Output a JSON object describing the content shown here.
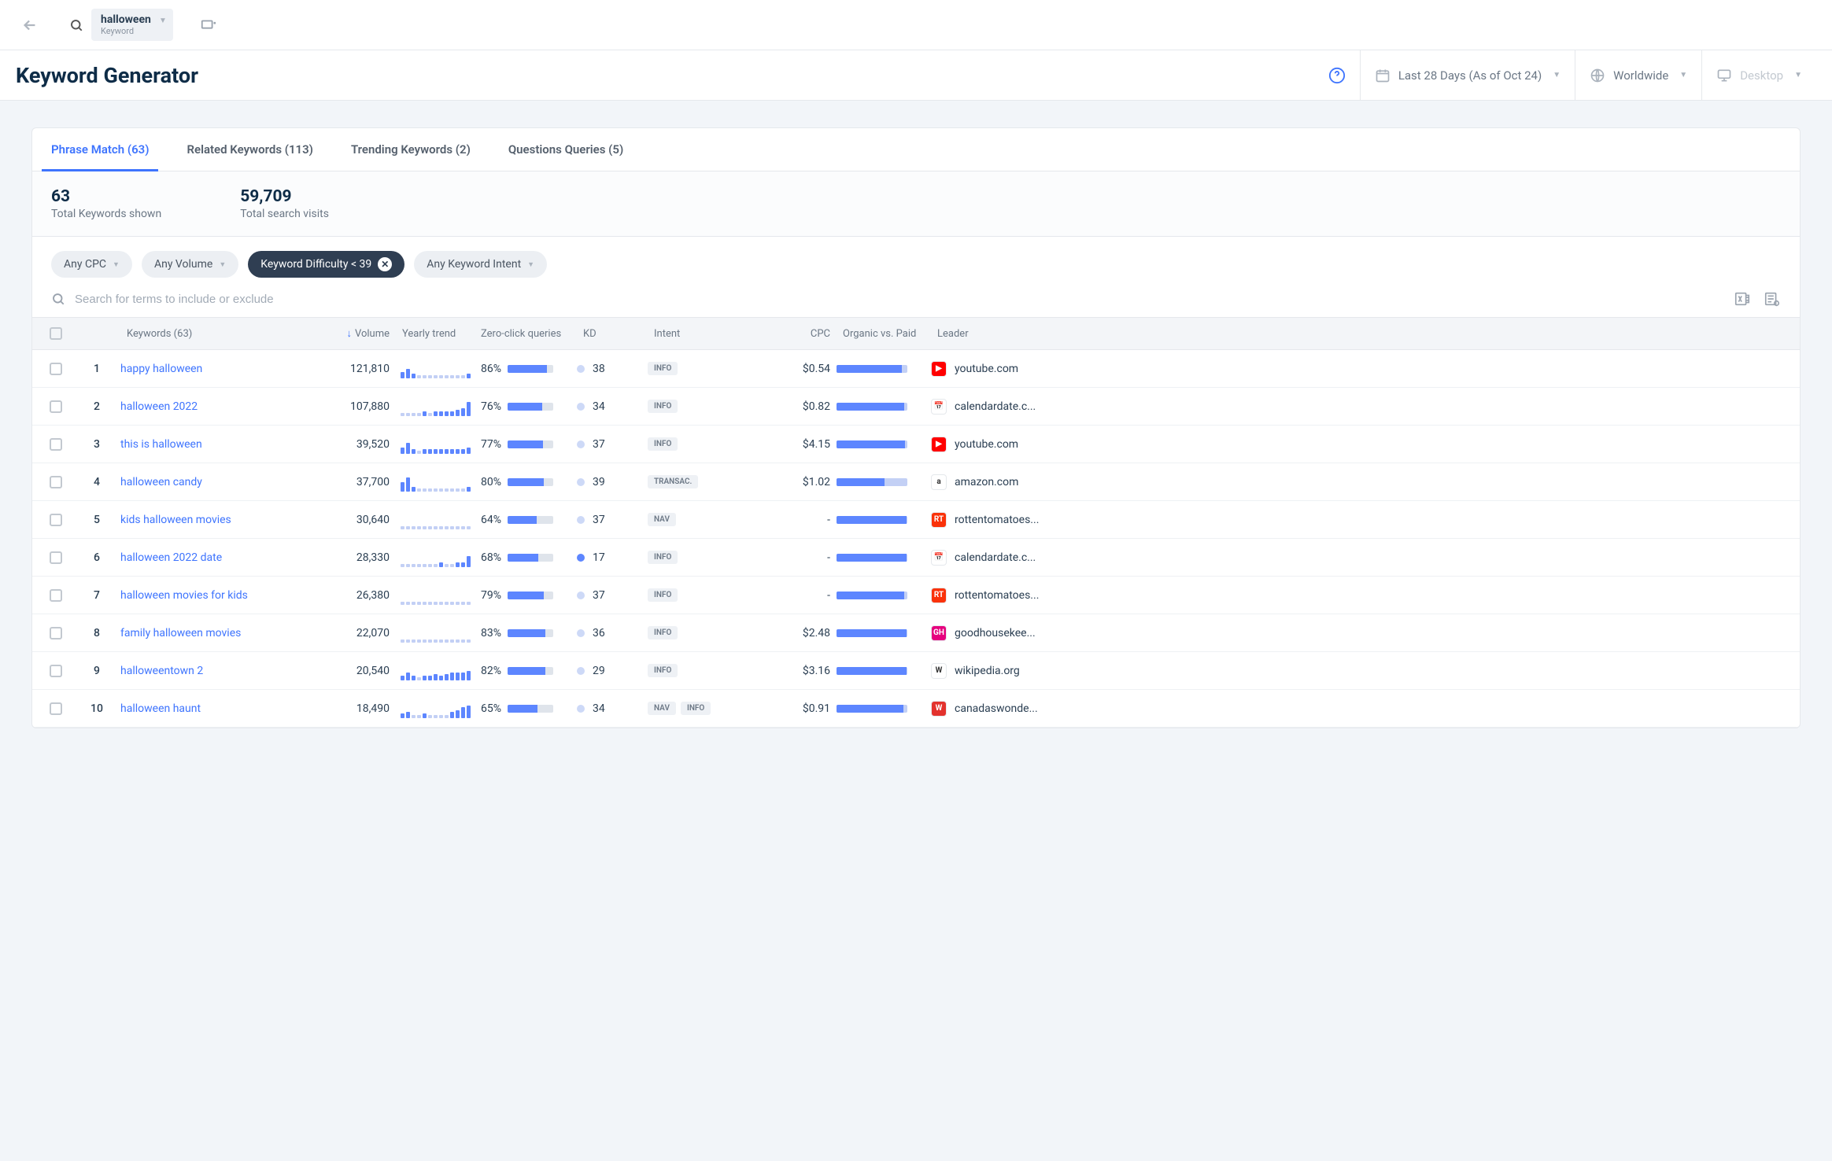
{
  "topbar": {
    "keyword": "halloween",
    "keyword_label": "Keyword"
  },
  "header": {
    "title": "Keyword Generator",
    "date_range": "Last 28 Days (As of Oct 24)",
    "region": "Worldwide",
    "device": "Desktop"
  },
  "tabs": [
    {
      "label": "Phrase Match (63)",
      "active": true
    },
    {
      "label": "Related Keywords (113)",
      "active": false
    },
    {
      "label": "Trending Keywords (2)",
      "active": false
    },
    {
      "label": "Questions Queries (5)",
      "active": false
    }
  ],
  "stats": {
    "total_keywords_num": "63",
    "total_keywords_label": "Total Keywords shown",
    "total_visits_num": "59,709",
    "total_visits_label": "Total search visits"
  },
  "filters": {
    "cpc": "Any CPC",
    "volume": "Any Volume",
    "difficulty": "Keyword Difficulty < 39",
    "intent": "Any Keyword Intent"
  },
  "search": {
    "placeholder": "Search for terms to include or exclude"
  },
  "columns": {
    "keywords": "Keywords (63)",
    "volume": "Volume",
    "yearly_trend": "Yearly trend",
    "zero_click": "Zero-click queries",
    "kd": "KD",
    "intent": "Intent",
    "cpc": "CPC",
    "ovp": "Organic vs. Paid",
    "leader": "Leader"
  },
  "rows": [
    {
      "idx": "1",
      "keyword": "happy halloween",
      "volume": "121,810",
      "spark": [
        4,
        6,
        3,
        2,
        2,
        2,
        2,
        2,
        2,
        2,
        2,
        2,
        3
      ],
      "zc_pct": "86%",
      "zc_fill": 86,
      "kd": "38",
      "kd_solid": false,
      "intents": [
        "INFO"
      ],
      "cpc": "$0.54",
      "ovp": 92,
      "leader": "youtube.com",
      "fav_bg": "#ff0000",
      "fav_txt": "▶"
    },
    {
      "idx": "2",
      "keyword": "halloween 2022",
      "volume": "107,880",
      "spark": [
        2,
        2,
        2,
        2,
        3,
        2,
        3,
        3,
        3,
        3,
        4,
        5,
        9
      ],
      "zc_pct": "76%",
      "zc_fill": 76,
      "kd": "34",
      "kd_solid": false,
      "intents": [
        "INFO"
      ],
      "cpc": "$0.82",
      "ovp": 95,
      "leader": "calendardate.c...",
      "fav_bg": "#ffffff",
      "fav_txt": "📅"
    },
    {
      "idx": "3",
      "keyword": "this is halloween",
      "volume": "39,520",
      "spark": [
        4,
        7,
        3,
        2,
        3,
        3,
        3,
        3,
        3,
        3,
        3,
        3,
        4
      ],
      "zc_pct": "77%",
      "zc_fill": 77,
      "kd": "37",
      "kd_solid": false,
      "intents": [
        "INFO"
      ],
      "cpc": "$4.15",
      "ovp": 97,
      "leader": "youtube.com",
      "fav_bg": "#ff0000",
      "fav_txt": "▶"
    },
    {
      "idx": "4",
      "keyword": "halloween candy",
      "volume": "37,700",
      "spark": [
        6,
        9,
        3,
        2,
        2,
        2,
        2,
        2,
        2,
        2,
        2,
        2,
        3
      ],
      "zc_pct": "80%",
      "zc_fill": 80,
      "kd": "39",
      "kd_solid": false,
      "intents": [
        "TRANSAC."
      ],
      "cpc": "$1.02",
      "ovp": 68,
      "leader": "amazon.com",
      "fav_bg": "#ffffff",
      "fav_txt": "a"
    },
    {
      "idx": "5",
      "keyword": "kids halloween movies",
      "volume": "30,640",
      "spark": [
        2,
        2,
        2,
        2,
        2,
        2,
        2,
        2,
        2,
        2,
        2,
        2,
        2
      ],
      "zc_pct": "64%",
      "zc_fill": 64,
      "kd": "37",
      "kd_solid": false,
      "intents": [
        "NAV"
      ],
      "cpc": "-",
      "ovp": 99,
      "leader": "rottentomatoes...",
      "fav_bg": "#fa320a",
      "fav_txt": "RT"
    },
    {
      "idx": "6",
      "keyword": "halloween 2022 date",
      "volume": "28,330",
      "spark": [
        2,
        2,
        2,
        2,
        2,
        2,
        2,
        3,
        2,
        2,
        3,
        3,
        7
      ],
      "zc_pct": "68%",
      "zc_fill": 68,
      "kd": "17",
      "kd_solid": true,
      "intents": [
        "INFO"
      ],
      "cpc": "-",
      "ovp": 99,
      "leader": "calendardate.c...",
      "fav_bg": "#ffffff",
      "fav_txt": "📅"
    },
    {
      "idx": "7",
      "keyword": "halloween movies for kids",
      "volume": "26,380",
      "spark": [
        2,
        2,
        2,
        2,
        2,
        2,
        2,
        2,
        2,
        2,
        2,
        2,
        2
      ],
      "zc_pct": "79%",
      "zc_fill": 79,
      "kd": "37",
      "kd_solid": false,
      "intents": [
        "INFO"
      ],
      "cpc": "-",
      "ovp": 95,
      "leader": "rottentomatoes...",
      "fav_bg": "#fa320a",
      "fav_txt": "RT"
    },
    {
      "idx": "8",
      "keyword": "family halloween movies",
      "volume": "22,070",
      "spark": [
        2,
        2,
        2,
        2,
        2,
        2,
        2,
        2,
        2,
        2,
        2,
        2,
        2
      ],
      "zc_pct": "83%",
      "zc_fill": 83,
      "kd": "36",
      "kd_solid": false,
      "intents": [
        "INFO"
      ],
      "cpc": "$2.48",
      "ovp": 99,
      "leader": "goodhousekee...",
      "fav_bg": "#e6007e",
      "fav_txt": "GH"
    },
    {
      "idx": "9",
      "keyword": "halloweentown 2",
      "volume": "20,540",
      "spark": [
        3,
        5,
        3,
        2,
        3,
        3,
        4,
        3,
        4,
        5,
        5,
        5,
        6
      ],
      "zc_pct": "82%",
      "zc_fill": 82,
      "kd": "29",
      "kd_solid": false,
      "intents": [
        "INFO"
      ],
      "cpc": "$3.16",
      "ovp": 99,
      "leader": "wikipedia.org",
      "fav_bg": "#ffffff",
      "fav_txt": "W"
    },
    {
      "idx": "10",
      "keyword": "halloween haunt",
      "volume": "18,490",
      "spark": [
        3,
        4,
        2,
        2,
        3,
        2,
        2,
        2,
        2,
        4,
        5,
        7,
        8
      ],
      "zc_pct": "65%",
      "zc_fill": 65,
      "kd": "34",
      "kd_solid": false,
      "intents": [
        "NAV",
        "INFO"
      ],
      "cpc": "$0.91",
      "ovp": 94,
      "leader": "canadaswonde...",
      "fav_bg": "#e3322d",
      "fav_txt": "W"
    }
  ]
}
